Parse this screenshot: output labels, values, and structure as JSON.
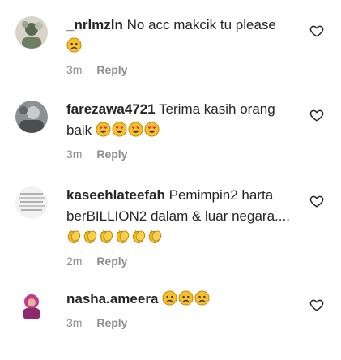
{
  "comments": [
    {
      "username": "_nrlmzln",
      "text": "No acc makcik tu please",
      "emojis": [
        "worried"
      ],
      "time": "3m",
      "reply_label": "Reply",
      "avatar_icon": "profile-photo-icon"
    },
    {
      "username": "farezawa4721",
      "text": "Terima kasih orang baik",
      "emojis": [
        "heart-eyes",
        "heart-eyes",
        "heart-eyes",
        "heart-eyes"
      ],
      "time": "3m",
      "reply_label": "Reply",
      "avatar_icon": "profile-photo-icon"
    },
    {
      "username": "kaseehlateefah",
      "text": "Pemimpin2 harta berBILLION2 dalam & luar negara....",
      "emojis": [
        "clap",
        "clap",
        "clap",
        "clap",
        "clap",
        "clap"
      ],
      "time": "2m",
      "reply_label": "Reply",
      "avatar_icon": "profile-photo-icon"
    },
    {
      "username": "nasha.ameera",
      "text": "",
      "emojis": [
        "worried",
        "worried",
        "worried"
      ],
      "time": "3m",
      "reply_label": "Reply",
      "avatar_icon": "profile-photo-icon"
    }
  ],
  "like_icon": "heart-outline-icon",
  "colors": {
    "text": "#262626",
    "meta": "#8e8e8e",
    "emoji_face": "#f5c02b"
  }
}
